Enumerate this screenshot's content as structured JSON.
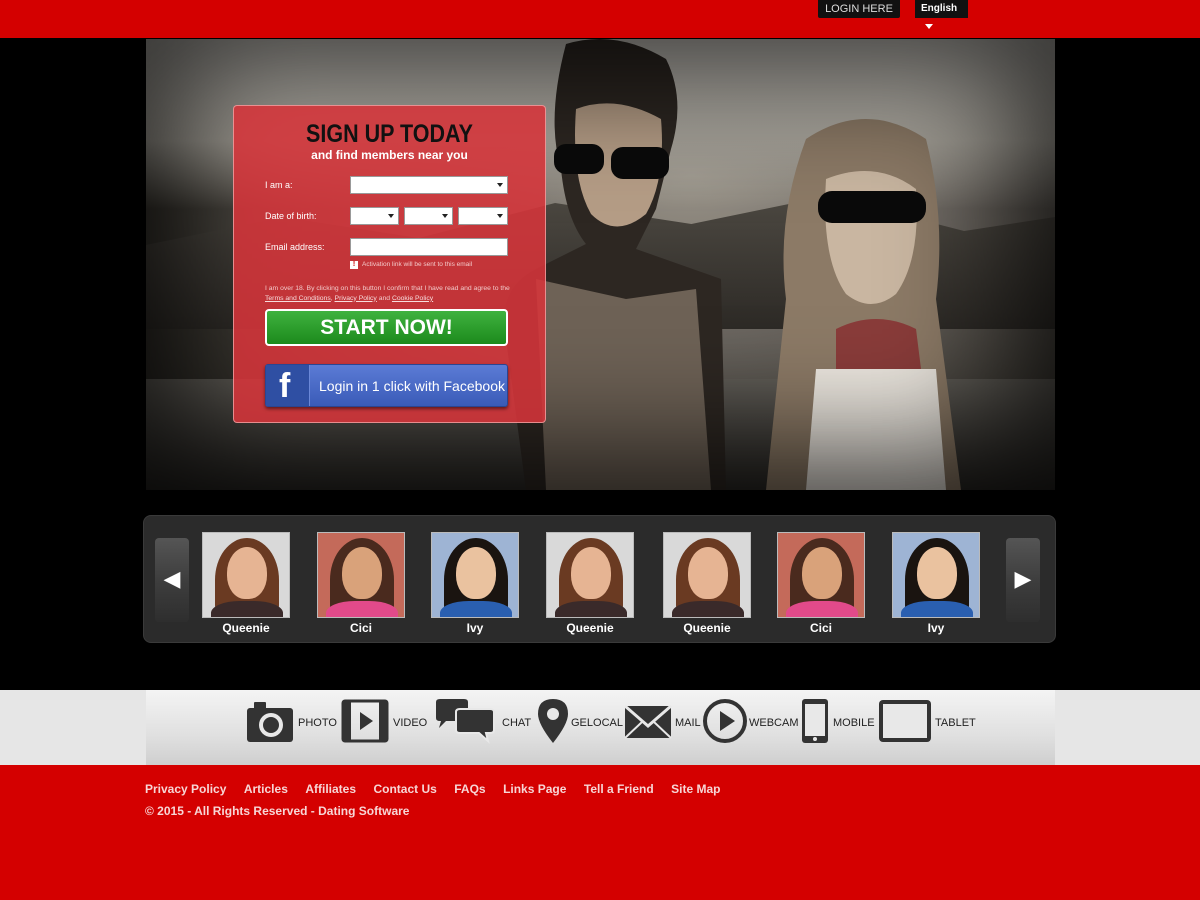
{
  "header": {
    "login_label": "LOGIN HERE",
    "language": "English"
  },
  "signup": {
    "title": "SIGN UP TODAY",
    "subtitle": "and find members near you",
    "iam_label": "I am a:",
    "dob_label": "Date of birth:",
    "email_label": "Email address:",
    "activation_note": "Activation link will be sent to this email",
    "terms_prefix": "I am over 18. By clicking on this button I confirm that I have read and agree to the ",
    "terms_link": "Terms and Conditions",
    "privacy_link": "Privacy Policy",
    "and_text": " and ",
    "cookie_link": "Cookie Policy",
    "start_label": "START NOW!",
    "facebook_label": "Login in 1 click with Facebook"
  },
  "carousel": {
    "members": [
      {
        "name": "Queenie"
      },
      {
        "name": "Cici"
      },
      {
        "name": "Ivy"
      },
      {
        "name": "Queenie"
      },
      {
        "name": "Queenie"
      },
      {
        "name": "Cici"
      },
      {
        "name": "Ivy"
      }
    ]
  },
  "features": [
    {
      "label": "PHOTO",
      "icon": "camera-icon"
    },
    {
      "label": "VIDEO",
      "icon": "film-icon"
    },
    {
      "label": "CHAT",
      "icon": "chat-icon"
    },
    {
      "label": "GELOCAL",
      "icon": "map-pin-icon"
    },
    {
      "label": "MAIL",
      "icon": "mail-icon"
    },
    {
      "label": "WEBCAM",
      "icon": "play-icon"
    },
    {
      "label": "MOBILE",
      "icon": "mobile-icon"
    },
    {
      "label": "TABLET",
      "icon": "tablet-icon"
    }
  ],
  "footer": {
    "links": [
      "Privacy Policy",
      "Articles",
      "Affiliates",
      "Contact Us",
      "FAQs",
      "Links Page",
      "Tell a Friend",
      "Site Map"
    ],
    "copyright": "© 2015 - All Rights Reserved -  Dating Software"
  },
  "colors": {
    "brand_red": "#d40000",
    "start_green": "#2a9e2a",
    "facebook_blue": "#3b5bb5"
  }
}
